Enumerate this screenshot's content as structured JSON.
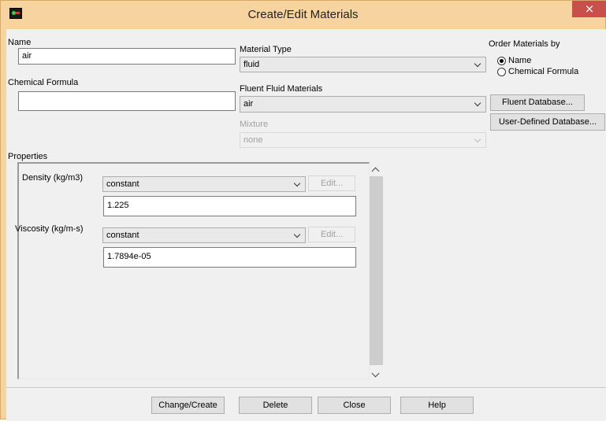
{
  "window": {
    "title": "Create/Edit Materials",
    "close_glyph": "×"
  },
  "name": {
    "label": "Name",
    "value": "air"
  },
  "chemical_formula": {
    "label": "Chemical Formula",
    "value": ""
  },
  "material_type": {
    "label": "Material Type",
    "value": "fluid"
  },
  "fluent_fluid_materials": {
    "label": "Fluent Fluid Materials",
    "value": "air"
  },
  "mixture": {
    "label": "Mixture",
    "value": "none"
  },
  "order_by": {
    "label": "Order Materials by",
    "options": [
      {
        "label": "Name",
        "selected": true
      },
      {
        "label": "Chemical Formula",
        "selected": false
      }
    ]
  },
  "database_buttons": {
    "fluent": "Fluent Database...",
    "user_defined": "User-Defined Database..."
  },
  "properties": {
    "label": "Properties",
    "density": {
      "label": "Density (kg/m3)",
      "method": "constant",
      "edit": "Edit...",
      "value": "1.225"
    },
    "viscosity": {
      "label": "Viscosity (kg/m-s)",
      "method": "constant",
      "edit": "Edit...",
      "value": "1.7894e-05"
    }
  },
  "footer_buttons": {
    "change_create": "Change/Create",
    "delete": "Delete",
    "close": "Close",
    "help": "Help"
  },
  "icons": {
    "app": "fluent-app-icon",
    "close": "close-icon",
    "dropdown": "chevron-down-icon",
    "scroll_up": "scroll-up-arrow-icon",
    "scroll_down": "scroll-down-arrow-icon"
  },
  "colors": {
    "frame": "#f6d39f",
    "close": "#c7504b",
    "dialog_bg": "#f0f0f0"
  }
}
